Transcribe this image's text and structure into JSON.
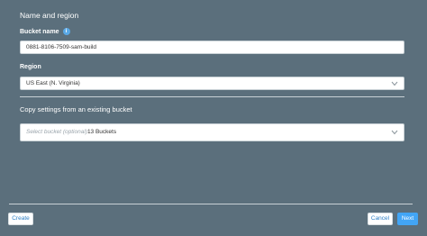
{
  "section": {
    "title": "Name and region"
  },
  "bucket_name": {
    "label": "Bucket name",
    "info_icon": "info-icon",
    "value": "0881-8106-7509-sam-build"
  },
  "region": {
    "label": "Region",
    "selected": "US East (N. Virginia)",
    "icon": "chevron-down-icon"
  },
  "copy_settings": {
    "title": "Copy settings from an existing bucket",
    "placeholder": "Select bucket (optional)",
    "count": "13 Buckets",
    "icon": "chevron-down-icon"
  },
  "footer": {
    "create_label": "Create",
    "cancel_label": "Cancel",
    "next_label": "Next"
  },
  "colors": {
    "background": "#5b6f7c",
    "primary": "#42a5f5",
    "link": "#2d7fc6"
  }
}
